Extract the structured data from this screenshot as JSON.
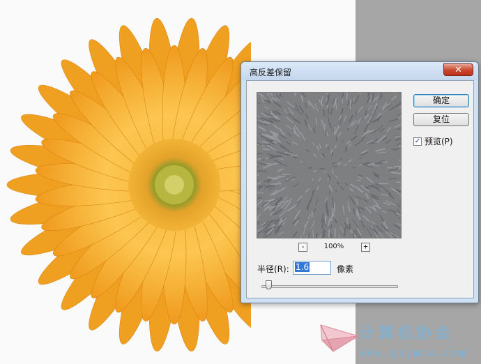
{
  "dialog": {
    "title": "高反差保留",
    "close_glyph": "✕",
    "ok_label": "确定",
    "reset_label": "复位",
    "preview_checkbox": {
      "label": "预览(P)",
      "checked": true,
      "glyph": "✓"
    },
    "zoom": {
      "minus": "-",
      "value": "100%",
      "plus": "+"
    },
    "radius": {
      "label": "半径(R):",
      "value": "1.6",
      "unit": "像素",
      "slider_fraction": 0.05
    }
  },
  "colors": {
    "dialog_frame": "#cfe0f3",
    "close_button": "#c7462c",
    "petal": "#f4a524",
    "preview_gray": "#7e7f81",
    "watermark": "#86aecb"
  },
  "watermark": {
    "title": "计算机协会",
    "url": "www.gxjmca.com",
    "logo_icon": "paper-plane-logo"
  }
}
